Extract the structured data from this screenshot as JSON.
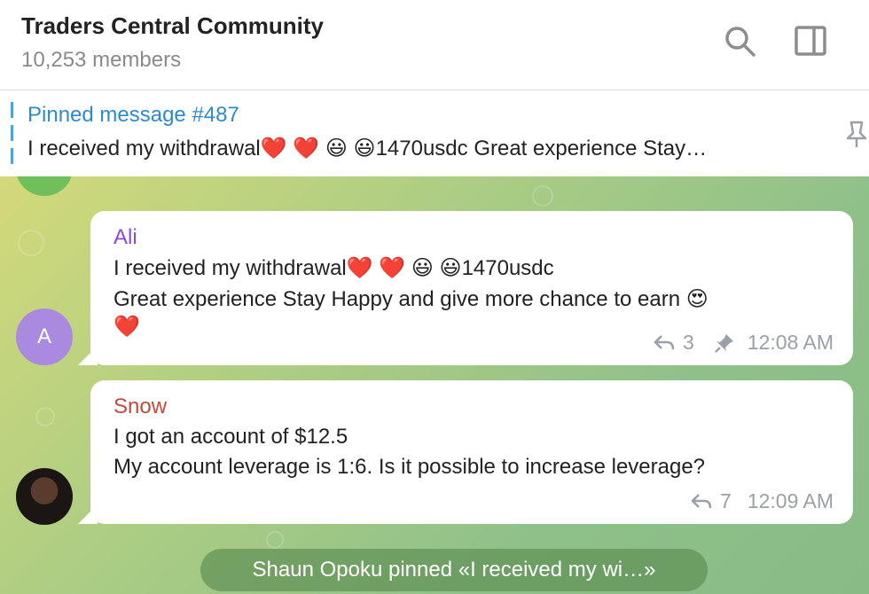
{
  "header": {
    "title": "Traders Central Community",
    "subtitle": "10,253 members"
  },
  "pinned": {
    "title": "Pinned message #487",
    "text": "I received my withdrawal❤️ ❤️ 😃 😃1470usdc  Great experience Stay…"
  },
  "messages": [
    {
      "avatar_letter": "A",
      "sender": "Ali",
      "lines": [
        "I received my withdrawal❤️ ❤️ 😃 😃1470usdc",
        "Great experience Stay Happy and give more chance to earn 😍",
        "❤️"
      ],
      "replies": "3",
      "time": "12:08 AM"
    },
    {
      "sender": "Snow",
      "lines": [
        "I got an account of $12.5",
        "My account leverage is 1:6. Is it possible to increase leverage?"
      ],
      "replies": "7",
      "time": "12:09 AM"
    }
  ],
  "service_message": "Shaun Opoku pinned «I received my wi…»",
  "colors": {
    "pinned_accent": "#2e8bc9",
    "ali_name": "#8b4ad6",
    "snow_name": "#c44a3a",
    "ali_avatar": "#a98ae0"
  }
}
